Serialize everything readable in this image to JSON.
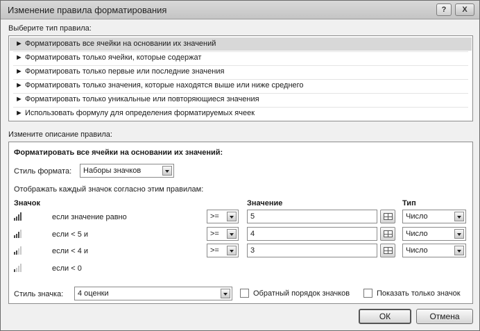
{
  "window": {
    "title": "Изменение правила форматирования",
    "help_label": "?",
    "close_label": "X"
  },
  "rule_type": {
    "heading": "Выберите тип правила:",
    "items": [
      {
        "label": "► Форматировать все ячейки на основании их значений",
        "selected": true
      },
      {
        "label": "► Форматировать только ячейки, которые содержат",
        "selected": false
      },
      {
        "label": "► Форматировать только первые или последние значения",
        "selected": false
      },
      {
        "label": "► Форматировать только значения, которые находятся выше или ниже среднего",
        "selected": false
      },
      {
        "label": "► Форматировать только уникальные или повторяющиеся значения",
        "selected": false
      },
      {
        "label": "► Использовать формулу для определения форматируемых ячеек",
        "selected": false
      }
    ]
  },
  "description": {
    "heading": "Измените описание правила:",
    "section_title": "Форматировать все ячейки на основании их значений:",
    "format_style_label": "Стиль формата:",
    "format_style_value": "Наборы значков",
    "display_hint": "Отображать каждый значок согласно этим правилам:",
    "columns": {
      "icon": "Значок",
      "value": "Значение",
      "type": "Тип"
    },
    "rows": [
      {
        "condition": "если значение равно",
        "operator": ">=",
        "value": "5",
        "type": "Число",
        "level": 1.0
      },
      {
        "condition": "если < 5 и",
        "operator": ">=",
        "value": "4",
        "type": "Число",
        "level": 0.75
      },
      {
        "condition": "если < 4 и",
        "operator": ">=",
        "value": "3",
        "type": "Число",
        "level": 0.5
      },
      {
        "condition": "если < 0",
        "level": 0.25
      }
    ],
    "icon_style_label": "Стиль значка:",
    "icon_style_value": "4 оценки",
    "reverse_order_label": "Обратный порядок значков",
    "reverse_order_checked": false,
    "show_icon_only_label": "Показать только значок",
    "show_icon_only_checked": false
  },
  "buttons": {
    "ok": "ОК",
    "cancel": "Отмена"
  },
  "colors": {
    "selected_row": "#d8d8d8",
    "bar_active": "#4a4a4a",
    "bar_inactive": "#c8c8c8"
  }
}
